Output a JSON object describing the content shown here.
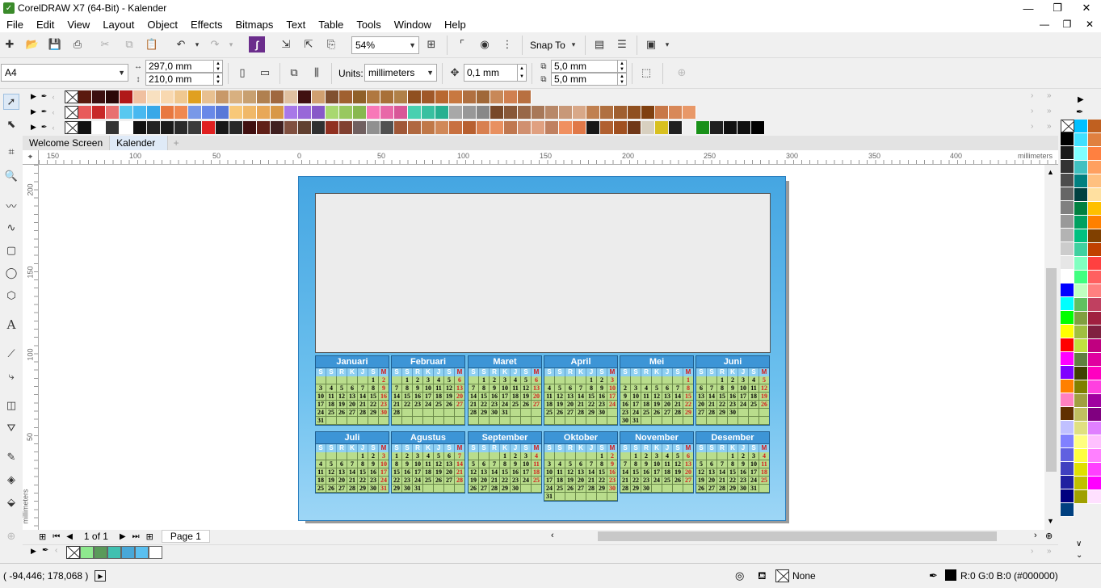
{
  "window": {
    "title": "CorelDRAW X7 (64-Bit) - Kalender"
  },
  "menu": [
    "File",
    "Edit",
    "View",
    "Layout",
    "Object",
    "Effects",
    "Bitmaps",
    "Text",
    "Table",
    "Tools",
    "Window",
    "Help"
  ],
  "toolbar": {
    "zoom": "54%",
    "snap_to": "Snap To"
  },
  "property_bar": {
    "page_size": "A4",
    "width": "297,0 mm",
    "height": "210,0 mm",
    "units_label": "Units:",
    "units": "millimeters",
    "nudge": "0,1 mm",
    "dup_x": "5,0 mm",
    "dup_y": "5,0 mm"
  },
  "tabs": [
    "Welcome Screen",
    "Kalender"
  ],
  "ruler": {
    "unit": "millimeters",
    "h_ticks": [
      "150",
      "100",
      "50",
      "0",
      "50",
      "100",
      "150",
      "200",
      "250",
      "300",
      "350",
      "400"
    ],
    "v_ticks": [
      "200",
      "150",
      "100",
      "50"
    ]
  },
  "page_nav": {
    "counter": "1 of 1",
    "page_tab": "Page 1"
  },
  "status": {
    "coords": "( -94,446; 178,068 )",
    "fill": "None",
    "color": "R:0 G:0 B:0 (#000000)"
  },
  "colors": {
    "accent": "#3d95d6",
    "weekend": "#d41b1b",
    "cell": "#b9dd8c"
  },
  "palette_rows": [
    [
      "#5a1a0e",
      "#3c0f0f",
      "#2a0808",
      "#b01818",
      "#f0c0a0",
      "#f8e0c0",
      "#f8d8b0",
      "#f0c890",
      "#e0a020",
      "#e8c090",
      "#c89868",
      "#d8b080",
      "#c8a070",
      "#b08050",
      "#a06840",
      "#e0c0a0",
      "#401010",
      "#d0a070",
      "#805030",
      "#a06030",
      "#906028",
      "#b07840",
      "#a87038",
      "#b08048",
      "#905020",
      "#a05828",
      "#b86830",
      "#c87840",
      "#b07040",
      "#a06838",
      "#c88858",
      "#d08050",
      "#b87040"
    ],
    [
      "#e85a5a",
      "#c82828",
      "#e87070",
      "#58c8f0",
      "#48b8f0",
      "#38a8e8",
      "#e87840",
      "#f08850",
      "#7898e8",
      "#6888e8",
      "#5878d8",
      "#f8c878",
      "#f0b868",
      "#e8a858",
      "#d89848",
      "#a878e8",
      "#9868d8",
      "#8858c8",
      "#a8d870",
      "#98c860",
      "#88b850",
      "#f878b8",
      "#e868a8",
      "#d85898",
      "#48d0b0",
      "#38c0a0",
      "#28b090",
      "#a8a8a8",
      "#989898",
      "#888888",
      "#784828",
      "#885838",
      "#986848",
      "#a87858",
      "#b88868",
      "#c89878",
      "#d8a888",
      "#c08050",
      "#b07040",
      "#a06030",
      "#905020",
      "#804010",
      "#c87848",
      "#d88858",
      "#e89868"
    ],
    [
      "#111111",
      "#ffffff",
      "#333333",
      "#ffffff",
      "#111111",
      "#222222",
      "#1a1a1a",
      "#2a2a2a",
      "#3a3a3a",
      "#e02020",
      "#181818",
      "#282828",
      "#401010",
      "#602018",
      "#402020",
      "#805040",
      "#604030",
      "#303030",
      "#903020",
      "#804030",
      "#706060",
      "#909090",
      "#505050",
      "#a05838",
      "#b06840",
      "#c07848",
      "#d08858",
      "#c87040",
      "#b86030",
      "#d88050",
      "#e89060",
      "#c07850",
      "#d09070",
      "#e0a080",
      "#c08060",
      "#f09060",
      "#e07848",
      "#181818",
      "#b06030",
      "#a05020",
      "#703818",
      "#d8d0c0",
      "#d8c020",
      "#202020",
      "#f0f0f0",
      "#189018",
      "#202020",
      "#111111",
      "#101010",
      "#000000"
    ]
  ],
  "right_palette": [
    [
      "#000000",
      "#1a1a1a",
      "#333333",
      "#4d4d4d",
      "#666666",
      "#808080",
      "#999999",
      "#b3b3b3",
      "#cccccc",
      "#e6e6e6",
      "#ffffff",
      "#0000ff",
      "#00ffff",
      "#00ff00",
      "#ffff00",
      "#ff0000",
      "#ff00ff",
      "#8000ff",
      "#ff8000",
      "#ff80c0",
      "#603000",
      "#c0c0ff",
      "#8080ff",
      "#6060e0",
      "#4040c0",
      "#2020a0",
      "#000080",
      "#004080"
    ],
    [
      "#00c0ff",
      "#40e0ff",
      "#80ffff",
      "#40c0c0",
      "#008080",
      "#004040",
      "#008040",
      "#00a060",
      "#00c080",
      "#40d0a0",
      "#80ffc0",
      "#40ff80",
      "#c0ffc0",
      "#60c060",
      "#80a040",
      "#a0c040",
      "#c0e040",
      "#608040",
      "#404000",
      "#808000",
      "#a0a040",
      "#c0c060",
      "#e0e080",
      "#ffff80",
      "#ffff40",
      "#e0e000",
      "#c0c000",
      "#a0a000"
    ],
    [
      "#c06020",
      "#e08040",
      "#ff8040",
      "#ffa060",
      "#ffc080",
      "#ffe0a0",
      "#ffc000",
      "#ff8000",
      "#804000",
      "#c04000",
      "#ff4040",
      "#ff6060",
      "#ff8080",
      "#c04060",
      "#a02040",
      "#802040",
      "#c00080",
      "#e000a0",
      "#ff00c0",
      "#ff40e0",
      "#a000a0",
      "#800080",
      "#e080ff",
      "#ffc0ff",
      "#ff80ff",
      "#ff40ff",
      "#ff00ff",
      "#ffe0ff"
    ]
  ],
  "doc_palette": [
    "#8ee88e",
    "#5a9a5a",
    "#40c0b0",
    "#48a8d8",
    "#5ac0f0",
    "#ffffff"
  ],
  "calendar": {
    "headers": [
      "S",
      "S",
      "R",
      "K",
      "J",
      "S",
      "M"
    ],
    "months": [
      {
        "name": "Januari",
        "rows": [
          [
            "",
            "",
            "",
            "",
            "",
            "1",
            "2"
          ],
          [
            "3",
            "4",
            "5",
            "6",
            "7",
            "8",
            "9"
          ],
          [
            "10",
            "11",
            "12",
            "13",
            "14",
            "15",
            "16"
          ],
          [
            "17",
            "18",
            "19",
            "20",
            "21",
            "22",
            "23"
          ],
          [
            "24",
            "25",
            "26",
            "27",
            "28",
            "29",
            "30"
          ],
          [
            "31",
            "",
            "",
            "",
            "",
            "",
            ""
          ]
        ]
      },
      {
        "name": "Februari",
        "rows": [
          [
            "",
            "1",
            "2",
            "3",
            "4",
            "5",
            "6"
          ],
          [
            "7",
            "8",
            "9",
            "10",
            "11",
            "12",
            "13"
          ],
          [
            "14",
            "15",
            "16",
            "17",
            "18",
            "19",
            "20"
          ],
          [
            "21",
            "22",
            "23",
            "24",
            "25",
            "26",
            "27"
          ],
          [
            "28",
            "",
            "",
            "",
            "",
            "",
            ""
          ],
          [
            "",
            "",
            "",
            "",
            "",
            "",
            ""
          ]
        ]
      },
      {
        "name": "Maret",
        "rows": [
          [
            "",
            "1",
            "2",
            "3",
            "4",
            "5",
            "6"
          ],
          [
            "7",
            "8",
            "9",
            "10",
            "11",
            "12",
            "13"
          ],
          [
            "14",
            "15",
            "16",
            "17",
            "18",
            "19",
            "20"
          ],
          [
            "21",
            "22",
            "23",
            "24",
            "25",
            "26",
            "27"
          ],
          [
            "28",
            "29",
            "30",
            "31",
            "",
            "",
            ""
          ],
          [
            "",
            "",
            "",
            "",
            "",
            "",
            ""
          ]
        ]
      },
      {
        "name": "April",
        "rows": [
          [
            "",
            "",
            "",
            "",
            "1",
            "2",
            "3"
          ],
          [
            "4",
            "5",
            "6",
            "7",
            "8",
            "9",
            "10"
          ],
          [
            "11",
            "12",
            "13",
            "14",
            "15",
            "16",
            "17"
          ],
          [
            "18",
            "19",
            "20",
            "21",
            "22",
            "23",
            "24"
          ],
          [
            "25",
            "26",
            "27",
            "28",
            "29",
            "30",
            ""
          ],
          [
            "",
            "",
            "",
            "",
            "",
            "",
            ""
          ]
        ]
      },
      {
        "name": "Mei",
        "rows": [
          [
            "",
            "",
            "",
            "",
            "",
            "",
            "1"
          ],
          [
            "2",
            "3",
            "4",
            "5",
            "6",
            "7",
            "8"
          ],
          [
            "9",
            "10",
            "11",
            "12",
            "13",
            "14",
            "15"
          ],
          [
            "16",
            "17",
            "18",
            "19",
            "20",
            "21",
            "22"
          ],
          [
            "23",
            "24",
            "25",
            "26",
            "27",
            "28",
            "29"
          ],
          [
            "30",
            "31",
            "",
            "",
            "",
            "",
            ""
          ]
        ]
      },
      {
        "name": "Juni",
        "rows": [
          [
            "",
            "",
            "1",
            "2",
            "3",
            "4",
            "5"
          ],
          [
            "6",
            "7",
            "8",
            "9",
            "10",
            "11",
            "12"
          ],
          [
            "13",
            "14",
            "15",
            "16",
            "17",
            "18",
            "19"
          ],
          [
            "20",
            "21",
            "22",
            "23",
            "24",
            "25",
            "26"
          ],
          [
            "27",
            "28",
            "29",
            "30",
            "",
            "",
            ""
          ],
          [
            "",
            "",
            "",
            "",
            "",
            "",
            ""
          ]
        ]
      },
      {
        "name": "Juli",
        "rows": [
          [
            "",
            "",
            "",
            "",
            "1",
            "2",
            "3"
          ],
          [
            "4",
            "5",
            "6",
            "7",
            "8",
            "9",
            "10"
          ],
          [
            "11",
            "12",
            "13",
            "14",
            "15",
            "16",
            "17"
          ],
          [
            "18",
            "19",
            "20",
            "21",
            "22",
            "23",
            "24"
          ],
          [
            "25",
            "26",
            "27",
            "28",
            "29",
            "30",
            "31"
          ]
        ]
      },
      {
        "name": "Agustus",
        "rows": [
          [
            "1",
            "2",
            "3",
            "4",
            "5",
            "6",
            "7"
          ],
          [
            "8",
            "9",
            "10",
            "11",
            "12",
            "13",
            "14"
          ],
          [
            "15",
            "16",
            "17",
            "18",
            "19",
            "20",
            "21"
          ],
          [
            "22",
            "23",
            "24",
            "25",
            "26",
            "27",
            "28"
          ],
          [
            "29",
            "30",
            "31",
            "",
            "",
            "",
            ""
          ]
        ]
      },
      {
        "name": "September",
        "rows": [
          [
            "",
            "",
            "",
            "1",
            "2",
            "3",
            "4"
          ],
          [
            "5",
            "6",
            "7",
            "8",
            "9",
            "10",
            "11"
          ],
          [
            "12",
            "13",
            "14",
            "15",
            "16",
            "17",
            "18"
          ],
          [
            "19",
            "20",
            "21",
            "22",
            "23",
            "24",
            "25"
          ],
          [
            "26",
            "27",
            "28",
            "29",
            "30",
            "",
            ""
          ]
        ]
      },
      {
        "name": "Oktober",
        "rows": [
          [
            "",
            "",
            "",
            "",
            "",
            "1",
            "2"
          ],
          [
            "3",
            "4",
            "5",
            "6",
            "7",
            "8",
            "9"
          ],
          [
            "10",
            "11",
            "12",
            "13",
            "14",
            "15",
            "16"
          ],
          [
            "17",
            "18",
            "19",
            "20",
            "21",
            "22",
            "23"
          ],
          [
            "24",
            "25",
            "26",
            "27",
            "28",
            "29",
            "30"
          ],
          [
            "31",
            "",
            "",
            "",
            "",
            "",
            ""
          ]
        ]
      },
      {
        "name": "November",
        "rows": [
          [
            "",
            "1",
            "2",
            "3",
            "4",
            "5",
            "6"
          ],
          [
            "7",
            "8",
            "9",
            "10",
            "11",
            "12",
            "13"
          ],
          [
            "14",
            "15",
            "16",
            "17",
            "18",
            "19",
            "20"
          ],
          [
            "21",
            "22",
            "23",
            "24",
            "25",
            "26",
            "27"
          ],
          [
            "28",
            "29",
            "30",
            "",
            "",
            "",
            ""
          ]
        ]
      },
      {
        "name": "Desember",
        "rows": [
          [
            "",
            "",
            "",
            "1",
            "2",
            "3",
            "4"
          ],
          [
            "5",
            "6",
            "7",
            "8",
            "9",
            "10",
            "11"
          ],
          [
            "12",
            "13",
            "14",
            "15",
            "16",
            "17",
            "18"
          ],
          [
            "19",
            "20",
            "21",
            "22",
            "23",
            "24",
            "25"
          ],
          [
            "26",
            "27",
            "28",
            "29",
            "30",
            "31",
            ""
          ]
        ]
      }
    ]
  }
}
